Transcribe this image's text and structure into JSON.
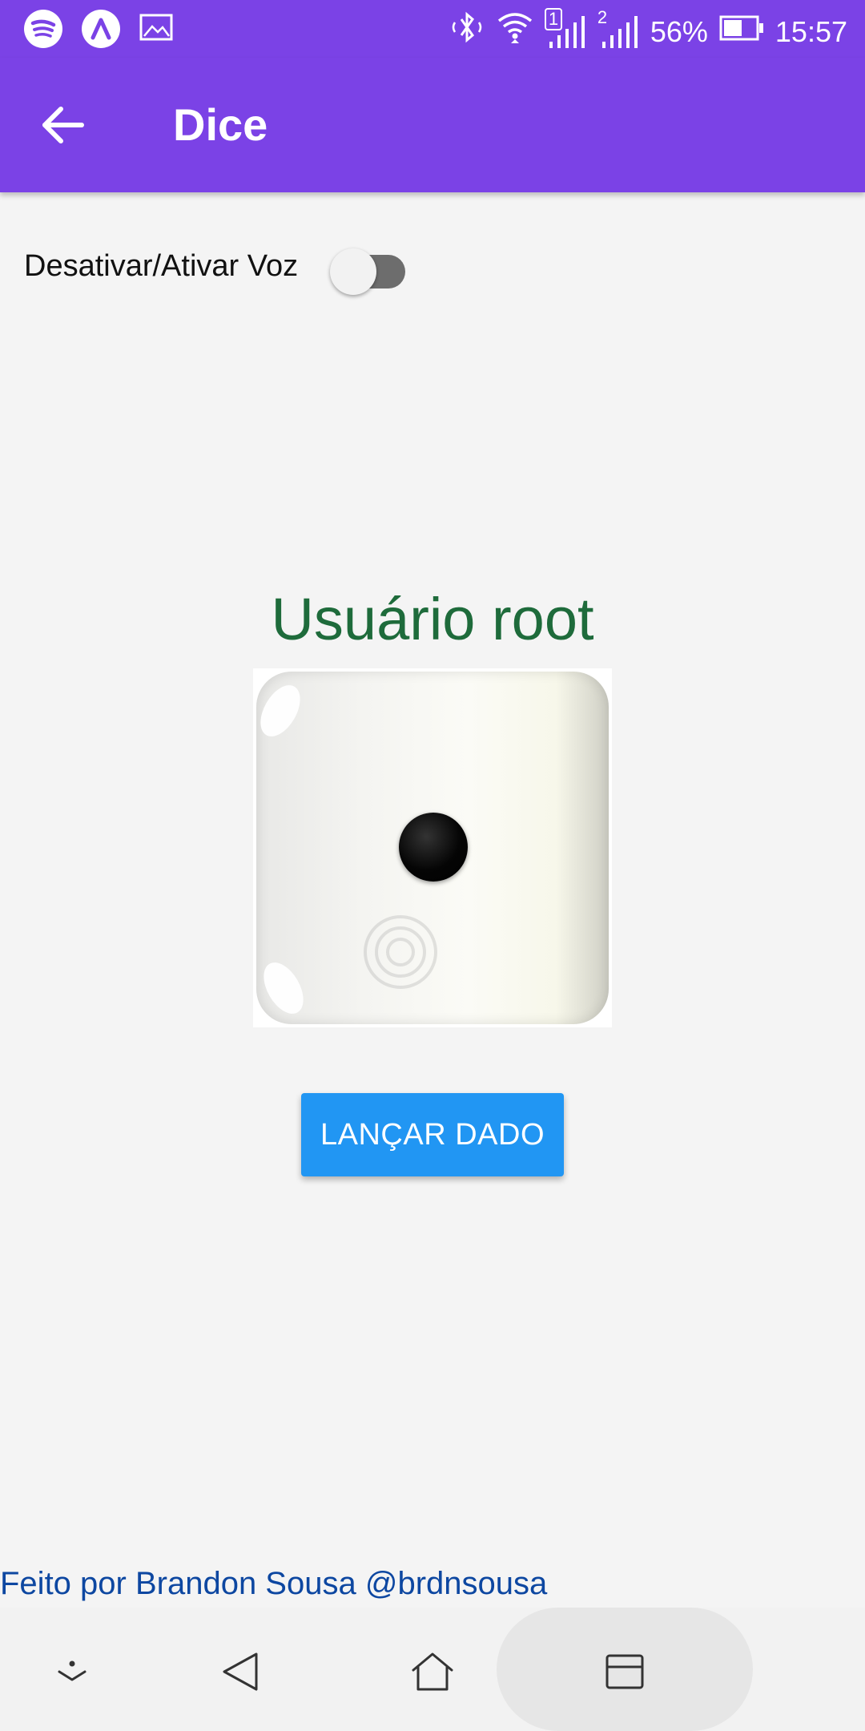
{
  "status_bar": {
    "battery_percent": "56%",
    "time": "15:57",
    "sim1_label": "1",
    "sim2_label": "2",
    "icons": [
      "spotify-icon",
      "app-logo-icon",
      "gallery-icon",
      "bluetooth-icon",
      "wifi-icon",
      "signal-sim1-icon",
      "signal-sim2-icon",
      "battery-icon"
    ]
  },
  "app_bar": {
    "title": "Dice",
    "back_icon": "arrow-back-icon"
  },
  "voice": {
    "label": "Desativar/Ativar Voz",
    "enabled": false
  },
  "user": {
    "label": "Usuário root"
  },
  "dice": {
    "face_value": 1
  },
  "actions": {
    "roll_label": "LANÇAR DADO"
  },
  "footer": {
    "credit": "Feito por Brandon Sousa @brdnsousa"
  },
  "nav": {
    "items": [
      "notifications-down-icon",
      "back-triangle-icon",
      "home-icon",
      "recents-icon"
    ]
  },
  "colors": {
    "primary": "#7b42e6",
    "button": "#2196f3",
    "user_text": "#1e6b3b",
    "credit_text": "#0d47a1"
  }
}
